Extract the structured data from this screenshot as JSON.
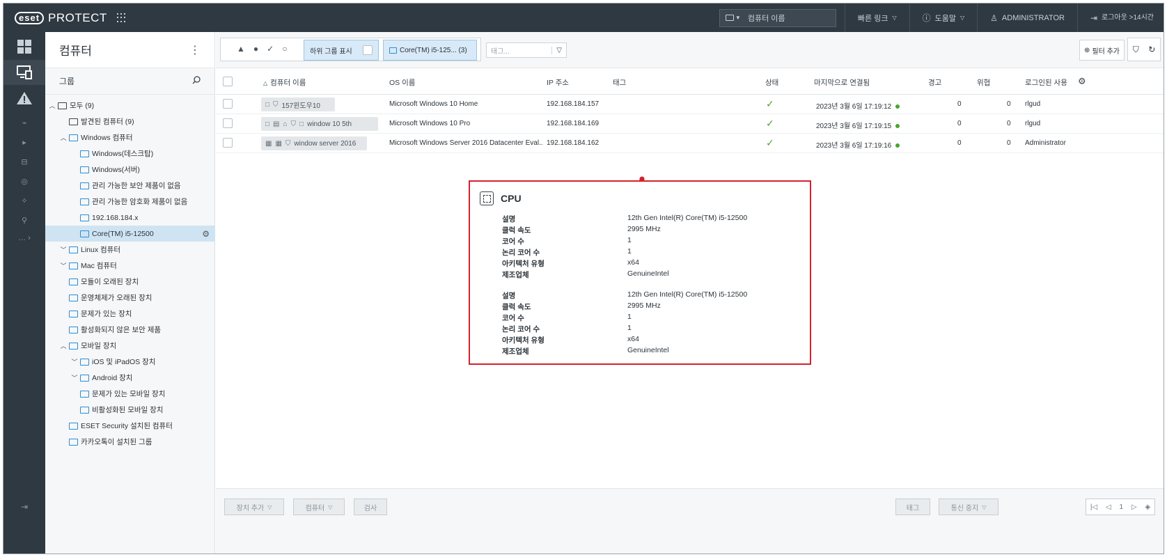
{
  "header": {
    "logo_badge": "eset",
    "product": "PROTECT",
    "search_placeholder": "컴퓨터 이름",
    "quick_links": "빠른 링크",
    "help": "도움말",
    "user": "ADMINISTRATOR",
    "logout": "로그아웃",
    "logout_time": ">14시간"
  },
  "groups": {
    "title": "컴퓨터",
    "subheader": "그룹",
    "tree": [
      {
        "label": "모두 (9)",
        "toggle": "^",
        "folder": "plain"
      },
      {
        "label": "발견된 컴퓨터 (9)",
        "toggle": "",
        "folder": "plain"
      },
      {
        "label": "Windows 컴퓨터",
        "toggle": "^",
        "folder": "blue"
      },
      {
        "label": "Windows(데스크탑)",
        "toggle": "",
        "folder": "blue"
      },
      {
        "label": "Windows(서버)",
        "toggle": "",
        "folder": "blue"
      },
      {
        "label": "관리 가능한 보안 제품이 없음",
        "toggle": "",
        "folder": "blue"
      },
      {
        "label": "관리 가능한 암호화 제품이 없음",
        "toggle": "",
        "folder": "blue"
      },
      {
        "label": "192.168.184.x",
        "toggle": "",
        "folder": "blue"
      },
      {
        "label": "Core(TM) i5-12500",
        "toggle": "",
        "folder": "blue"
      },
      {
        "label": "Linux 컴퓨터",
        "toggle": "v",
        "folder": "blue"
      },
      {
        "label": "Mac 컴퓨터",
        "toggle": "v",
        "folder": "blue"
      },
      {
        "label": "모듈이 오래된 장치",
        "toggle": "",
        "folder": "blue"
      },
      {
        "label": "운영체제가 오래된 장치",
        "toggle": "",
        "folder": "blue"
      },
      {
        "label": "문제가 있는 장치",
        "toggle": "",
        "folder": "blue"
      },
      {
        "label": "활성화되지 않은 보안 제품",
        "toggle": "",
        "folder": "blue"
      },
      {
        "label": "모바일 장치",
        "toggle": "^",
        "folder": "blue"
      },
      {
        "label": "iOS 및 iPadOS 장치",
        "toggle": "v",
        "folder": "blue"
      },
      {
        "label": "Android 장치",
        "toggle": "v",
        "folder": "blue"
      },
      {
        "label": "문제가 있는 모바일 장치",
        "toggle": "",
        "folder": "blue"
      },
      {
        "label": "비활성화된 모바일 장치",
        "toggle": "",
        "folder": "blue"
      },
      {
        "label": "ESET Security 설치된 컴퓨터",
        "toggle": "",
        "folder": "blue"
      },
      {
        "label": "카카오톡이 설치된 그룹",
        "toggle": "",
        "folder": "blue"
      }
    ]
  },
  "filters": {
    "show_subgroups": "하위 그룹 표시",
    "group_chip": "Core(TM) i5-125... (3)",
    "tag_placeholder": "태그...",
    "add_filter": "필터 추가"
  },
  "table": {
    "columns": {
      "name": "컴퓨터 이름",
      "os": "OS 이름",
      "ip": "IP 주소",
      "tag": "태그",
      "status": "상태",
      "last_connected": "마지막으로 연결됨",
      "alerts": "경고",
      "threats": "위협",
      "logged_user": "로그인된 사용"
    },
    "rows": [
      {
        "name": "157윈도우10",
        "os": "Microsoft Windows 10 Home",
        "ip": "192.168.184.157",
        "last": "2023년 3월 6일 17:19:12",
        "alerts": "0",
        "threats": "0",
        "user": "rlgud"
      },
      {
        "name": "window 10 5th",
        "os": "Microsoft Windows 10 Pro",
        "ip": "192.168.184.169",
        "last": "2023년 3월 6일 17:19:15",
        "alerts": "0",
        "threats": "0",
        "user": "rlgud"
      },
      {
        "name": "window server 2016",
        "os": "Microsoft Windows Server 2016 Datacenter Eval...",
        "ip": "192.168.184.162",
        "last": "2023년 3월 6일 17:19:16",
        "alerts": "0",
        "threats": "0",
        "user": "Administrator"
      }
    ]
  },
  "cpu": {
    "title": "CPU",
    "blocks": [
      {
        "items": [
          {
            "k": "설명",
            "v": "12th Gen Intel(R) Core(TM) i5-12500"
          },
          {
            "k": "클럭 속도",
            "v": "2995 MHz"
          },
          {
            "k": "코어 수",
            "v": "1"
          },
          {
            "k": "논리 코어 수",
            "v": "1"
          },
          {
            "k": "아키텍처 유형",
            "v": "x64"
          },
          {
            "k": "제조업체",
            "v": "GenuineIntel"
          }
        ]
      },
      {
        "items": [
          {
            "k": "설명",
            "v": "12th Gen Intel(R) Core(TM) i5-12500"
          },
          {
            "k": "클럭 속도",
            "v": "2995 MHz"
          },
          {
            "k": "코어 수",
            "v": "1"
          },
          {
            "k": "논리 코어 수",
            "v": "1"
          },
          {
            "k": "아키텍처 유형",
            "v": "x64"
          },
          {
            "k": "제조업체",
            "v": "GenuineIntel"
          }
        ]
      }
    ]
  },
  "bottom": {
    "add_device": "장치 추가",
    "computer": "컴퓨터",
    "inspect": "검사",
    "tag": "태그",
    "mute": "통신 중지",
    "page": "1"
  },
  "colors": {
    "topbar": "#2f3942",
    "accent": "#2a8dd4",
    "highlight_border": "#d3212c",
    "ok_green": "#4aa52e"
  }
}
